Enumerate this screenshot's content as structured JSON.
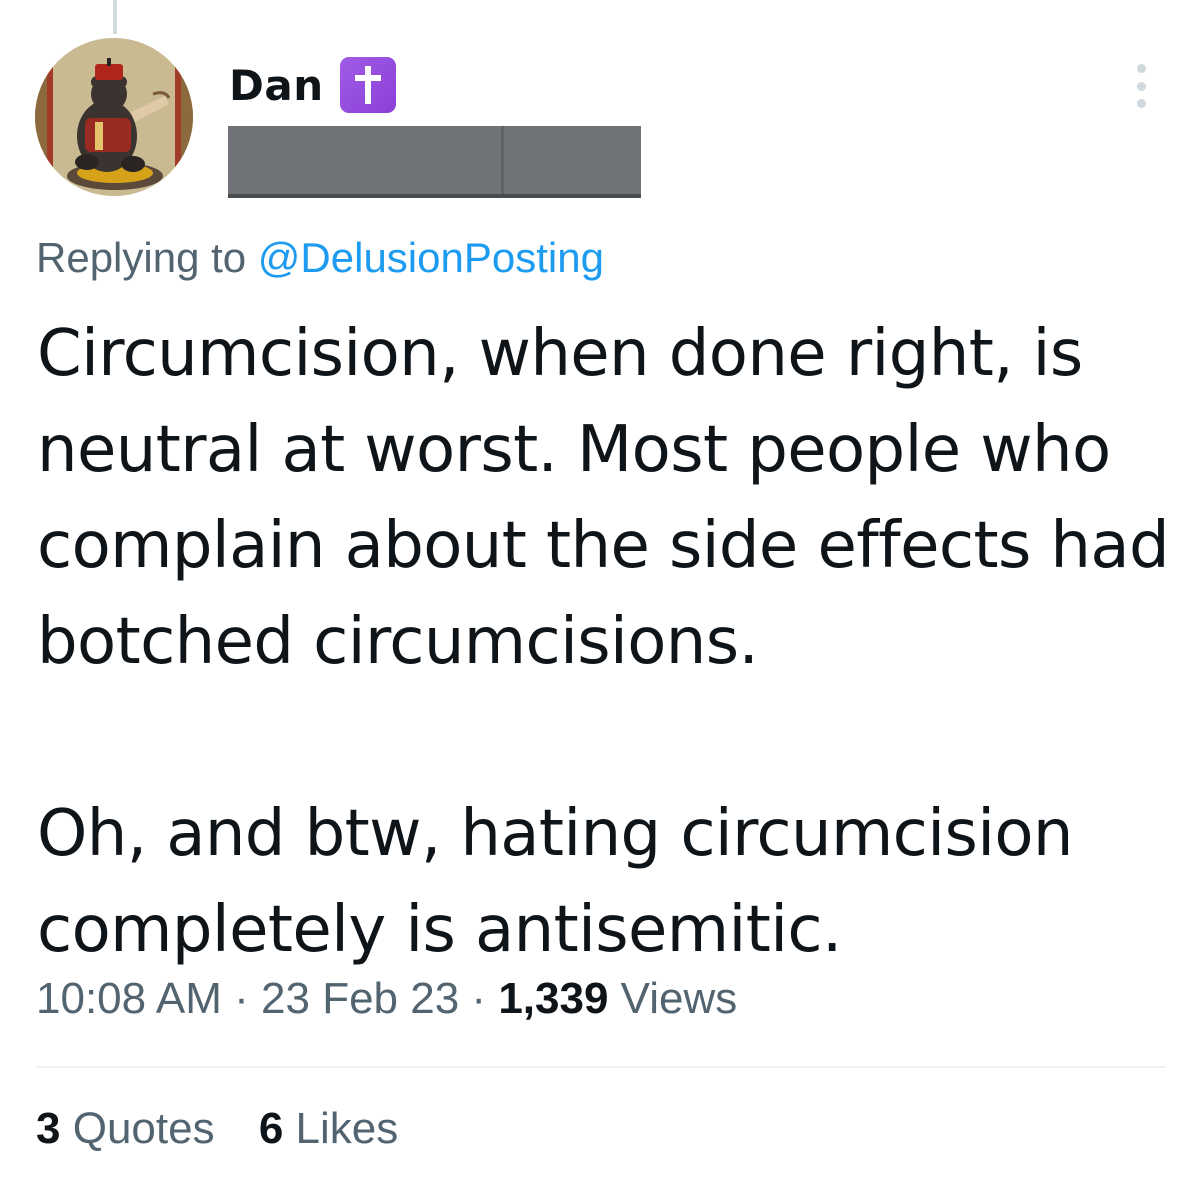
{
  "tweet": {
    "author": {
      "display_name": "Dan",
      "badge_emoji": "latin-cross-emoji",
      "handle_redacted": true
    },
    "reply": {
      "prefix": "Replying to",
      "handle": "@DelusionPosting"
    },
    "text_paragraphs": [
      "Circumcision, when done right, is neutral at worst. Most people who complain about the side effects had botched circumcisions.",
      "Oh, and btw, hating circumcision completely is antisemitic."
    ],
    "meta": {
      "time": "10:08 AM",
      "separator": "·",
      "date": "23 Feb 23",
      "views_count": "1,339",
      "views_label": "Views"
    },
    "stats": {
      "quotes_count": "3",
      "quotes_label": "Quotes",
      "likes_count": "6",
      "likes_label": "Likes"
    }
  },
  "colors": {
    "primary_text": "#0f1419",
    "secondary_text": "#536471",
    "link": "#1d9bf0",
    "divider": "#eff3f4",
    "badge_purple": "#9b50e0",
    "redaction_gray": "#6f7377"
  }
}
